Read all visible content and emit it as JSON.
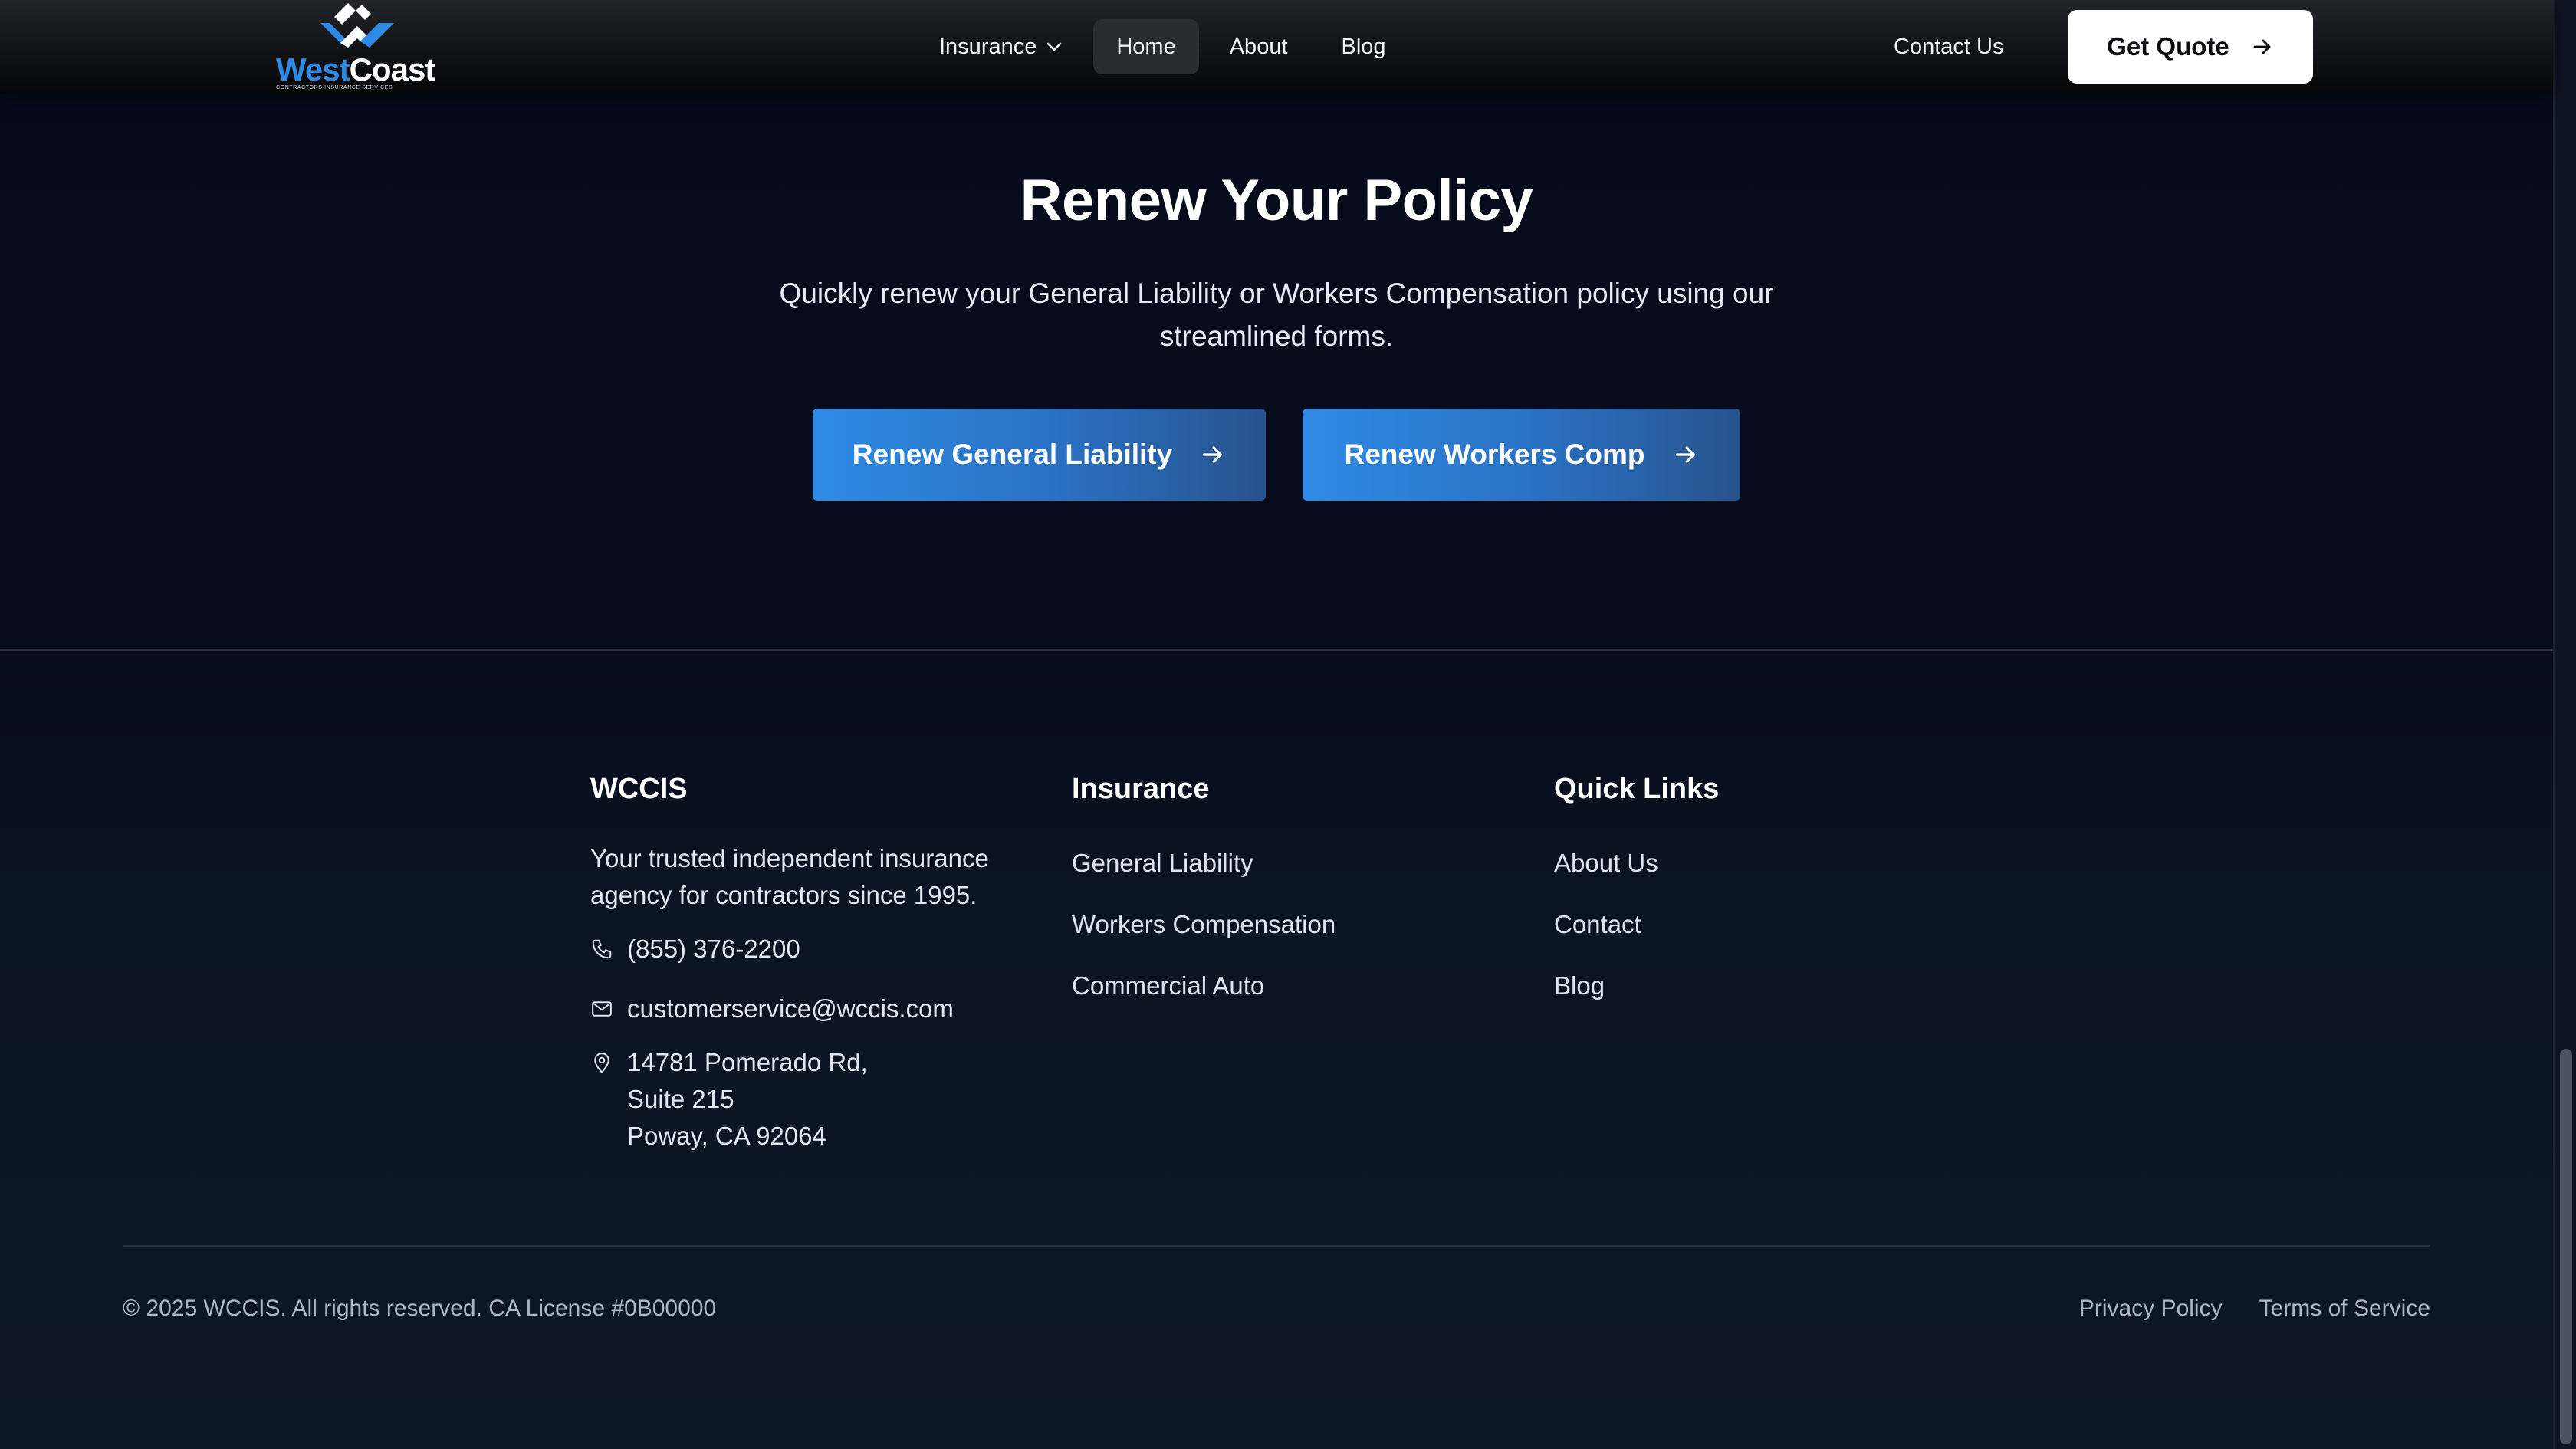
{
  "header": {
    "logo": {
      "word_west": "West",
      "word_coast": "Coast",
      "tagline": "CONTRACTORS INSURANCE SERVICES",
      "icon": "westcoast-logo-mark"
    },
    "nav": [
      {
        "label": "Insurance",
        "has_dropdown": true,
        "icon": "chevron-down-icon"
      },
      {
        "label": "Home",
        "active": true
      },
      {
        "label": "About"
      },
      {
        "label": "Blog"
      }
    ],
    "contact_label": "Contact Us",
    "quote_label": "Get Quote",
    "quote_icon": "arrow-right-icon"
  },
  "renew": {
    "title": "Renew Your Policy",
    "subtitle": "Quickly renew your General Liability or Workers Compensation policy using our streamlined forms.",
    "buttons": [
      {
        "label": "Renew General Liability",
        "icon": "arrow-right-icon"
      },
      {
        "label": "Renew Workers Comp",
        "icon": "arrow-right-icon"
      }
    ]
  },
  "footer": {
    "about": {
      "title": "WCCIS",
      "text": "Your trusted independent insurance agency for contractors since 1995.",
      "phone": "(855) 376-2200",
      "email": "customerservice@wccis.com",
      "address": [
        "14781 Pomerado Rd,",
        "Suite 215",
        "Poway, CA 92064"
      ]
    },
    "insurance": {
      "title": "Insurance",
      "links": [
        "General Liability",
        "Workers Compensation",
        "Commercial Auto"
      ]
    },
    "quick_links": {
      "title": "Quick Links",
      "links": [
        "About Us",
        "Contact",
        "Blog"
      ]
    },
    "copyright": "© 2025 WCCIS. All rights reserved. CA License #0B00000",
    "legal": [
      "Privacy Policy",
      "Terms of Service"
    ]
  },
  "colors": {
    "accent_blue": "#2e8be5",
    "background": "#070d1d",
    "header_bg": "#121316"
  }
}
